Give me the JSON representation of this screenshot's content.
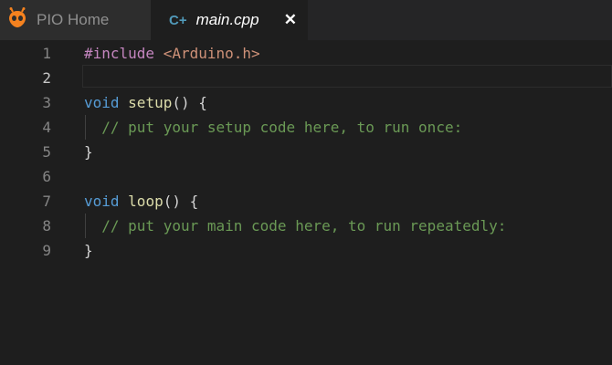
{
  "tabs": [
    {
      "label": "PIO Home",
      "icon": "platformio-alien-icon"
    },
    {
      "label": "main.cpp",
      "icon": "cpp-file-icon",
      "icon_text": "C+",
      "close": "✕",
      "active": true
    }
  ],
  "editor": {
    "active_line": 2,
    "lines": [
      {
        "n": "1",
        "tokens": [
          [
            "pp",
            "#include"
          ],
          [
            "",
            "' '"
          ],
          [
            "str",
            "<Arduino.h>"
          ]
        ]
      },
      {
        "n": "2",
        "tokens": []
      },
      {
        "n": "3",
        "tokens": [
          [
            "kw",
            "void"
          ],
          [
            "",
            ""
          ],
          [
            "fn",
            "setup"
          ],
          [
            "",
            "() {"
          ]
        ]
      },
      {
        "n": "4",
        "tokens": [
          [
            "cm",
            "  // put your setup code here, to run once:"
          ]
        ]
      },
      {
        "n": "5",
        "tokens": [
          [
            "",
            "}"
          ]
        ]
      },
      {
        "n": "6",
        "tokens": []
      },
      {
        "n": "7",
        "tokens": [
          [
            "kw",
            "void"
          ],
          [
            "",
            ""
          ],
          [
            "fn",
            "loop"
          ],
          [
            "",
            "() {"
          ]
        ]
      },
      {
        "n": "8",
        "tokens": [
          [
            "cm",
            "  // put your main code here, to run repeatedly:"
          ]
        ]
      },
      {
        "n": "9",
        "tokens": [
          [
            "",
            "}"
          ]
        ]
      }
    ]
  }
}
